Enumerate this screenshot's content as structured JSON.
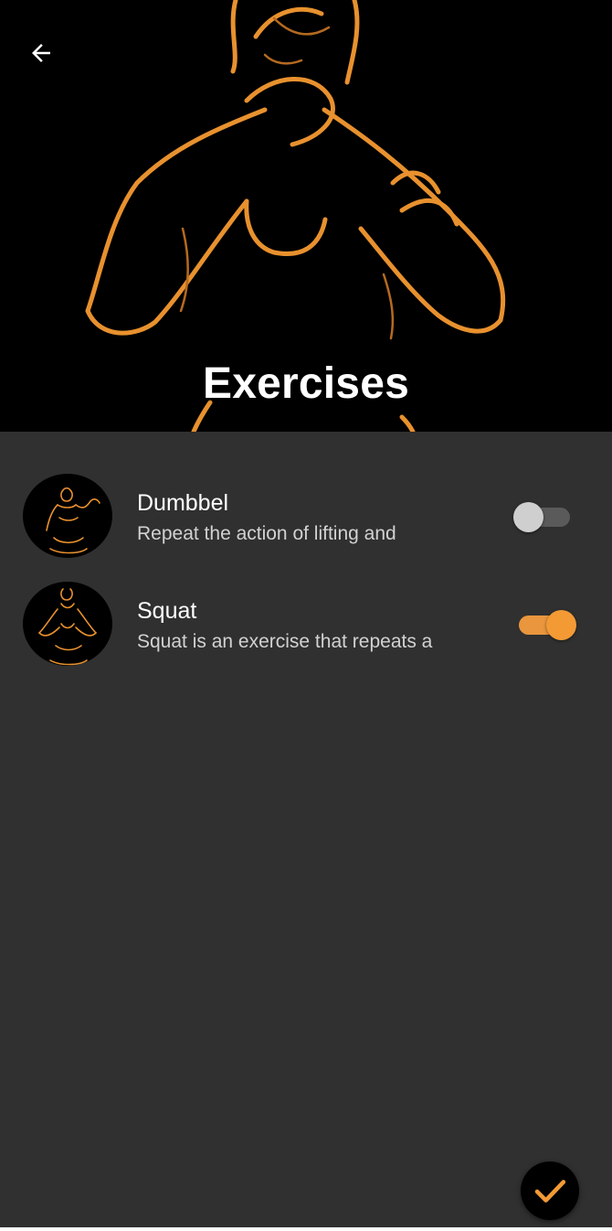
{
  "header": {
    "title": "Exercises",
    "back_icon": "arrow-back-icon"
  },
  "exercises": [
    {
      "name": "Dumbbel",
      "description": "Repeat the action of lifting and",
      "enabled": false
    },
    {
      "name": "Squat",
      "description": "Squat is an exercise that repeats a",
      "enabled": true
    }
  ],
  "fab": {
    "icon": "check-icon"
  },
  "colors": {
    "background": "#303030",
    "accent": "#f39a35",
    "hero_background": "#000000",
    "switch_off_thumb": "#cfcfcf",
    "switch_off_track": "#5a5a5a"
  }
}
